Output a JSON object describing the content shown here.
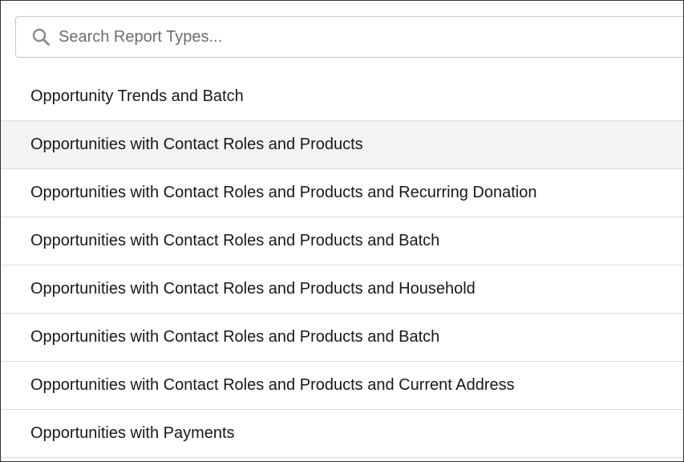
{
  "search": {
    "placeholder": "Search Report Types...",
    "value": ""
  },
  "report_types": [
    {
      "label": "Opportunity Trends and Batch",
      "highlighted": false
    },
    {
      "label": "Opportunities with Contact Roles and Products",
      "highlighted": true
    },
    {
      "label": "Opportunities with Contact Roles and Products and Recurring Donation",
      "highlighted": false
    },
    {
      "label": "Opportunities with Contact Roles and Products and Batch",
      "highlighted": false
    },
    {
      "label": "Opportunities with Contact Roles and Products and Household",
      "highlighted": false
    },
    {
      "label": "Opportunities with Contact Roles and Products and Batch",
      "highlighted": false
    },
    {
      "label": "Opportunities with Contact Roles and Products and Current Address",
      "highlighted": false
    },
    {
      "label": "Opportunities with Payments",
      "highlighted": false
    }
  ],
  "colors": {
    "highlight_bg": "#f3f3f3",
    "divider": "#dddbda",
    "text": "#181818",
    "placeholder": "#706e6b"
  },
  "icons": {
    "search": "search-icon"
  }
}
